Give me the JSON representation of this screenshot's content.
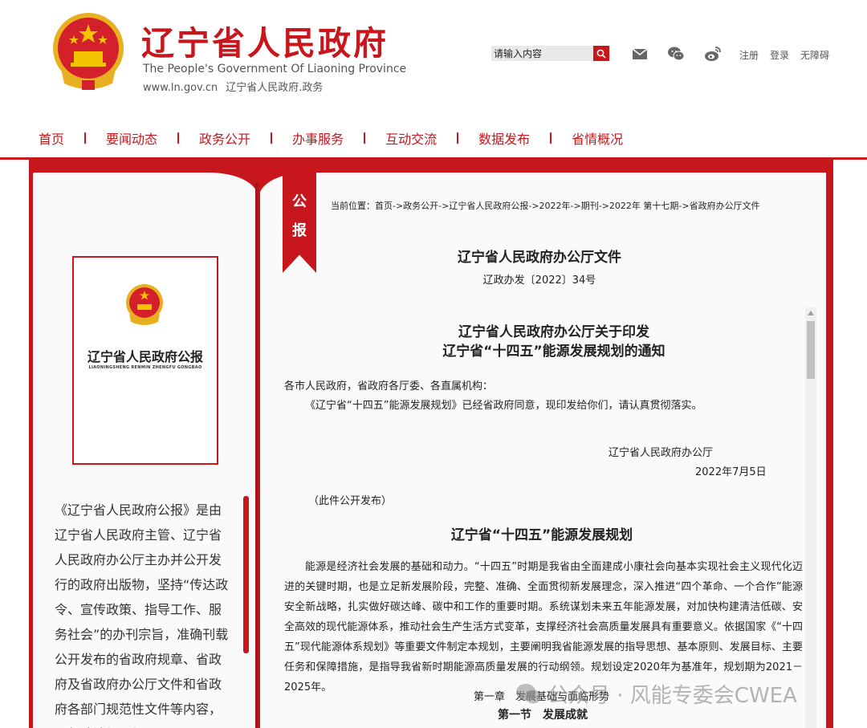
{
  "header": {
    "title": "辽宁省人民政府",
    "subtitle_en": "The People's Government Of Liaoning Province",
    "url": "www.ln.gov.cn",
    "url_tag": "辽宁省人民政府.政务",
    "search_placeholder": "请输入内容",
    "links": {
      "register": "注册",
      "login": "登录",
      "accessibility": "无障碍"
    },
    "icons": [
      "mail-icon",
      "wechat-icon",
      "weibo-icon",
      "search-icon"
    ]
  },
  "nav": {
    "items": [
      "首页",
      "要闻动态",
      "政务公开",
      "办事服务",
      "互动交流",
      "数据发布",
      "省情概况"
    ]
  },
  "sidebar": {
    "cover_title": "辽宁省人民政府公报",
    "cover_subtitle": "LIAONINGSHENG RENMIN ZHENGFU GONGBAO",
    "intro": "《辽宁省人民政府公报》是由辽宁省人民政府主管、辽宁省人民政府办公厅主办并公开发行的政府出版物，坚持“传达政令、宣传政策、指导工作、服务社会”的办刊宗旨，准确刊载公开发布的省政府规章、省政府及省政府办公厅文件和省政府各部门规范性文件等内容，是行政法规、规"
  },
  "ribbon": {
    "char1": "公",
    "char2": "报"
  },
  "document": {
    "breadcrumb": "当前位置：首页->政务公开->辽宁省人民政府公报->2022年->期刊->2022年 第十七期->省政府办公厅文件",
    "office_heading": "辽宁省人民政府办公厅文件",
    "doc_number": "辽政办发〔2022〕34号",
    "title_line1": "辽宁省人民政府办公厅关于印发",
    "title_line2": "辽宁省“十四五”能源发展规划的通知",
    "addressee": "各市人民政府，省政府各厅委、各直属机构：",
    "body": "《辽宁省“十四五”能源发展规划》已经省政府同意，现印发给你们，请认真贯彻落实。",
    "issuer": "辽宁省人民政府办公厅",
    "date": "2022年7月5日",
    "public_note": "（此件公开发布）",
    "plan_title": "辽宁省“十四五”能源发展规划",
    "paragraph": "能源是经济社会发展的基础和动力。“十四五”时期是我省由全面建成小康社会向基本实现社会主义现代化迈进的关键时期，也是立足新发展阶段，完整、准确、全面贯彻新发展理念，深入推进“四个革命、一个合作”能源安全新战略，扎实做好碳达峰、碳中和工作的重要时期。系统谋划未来五年能源发展，对加快构建清洁低碳、安全高效的现代能源体系，推动社会生产生活方式变革，支撑经济社会高质量发展具有重要意义。依据国家《“十四五”现代能源体系规划》等重要文件制定本规划，主要阐明我省能源发展的指导思想、基本原则、发展目标、主要任务和保障措施，是指导我省新时期能源高质量发展的行动纲领。规划设定2020年为基准年，规划期为2021－2025年。",
    "chapter": "第一章　发展基础与面临形势",
    "section": "第一节　发展成就"
  },
  "watermark": {
    "text": "公众号 · 风能专委会CWEA"
  },
  "colors": {
    "brand_red": "#c8161d",
    "gold": "#e8b020"
  }
}
